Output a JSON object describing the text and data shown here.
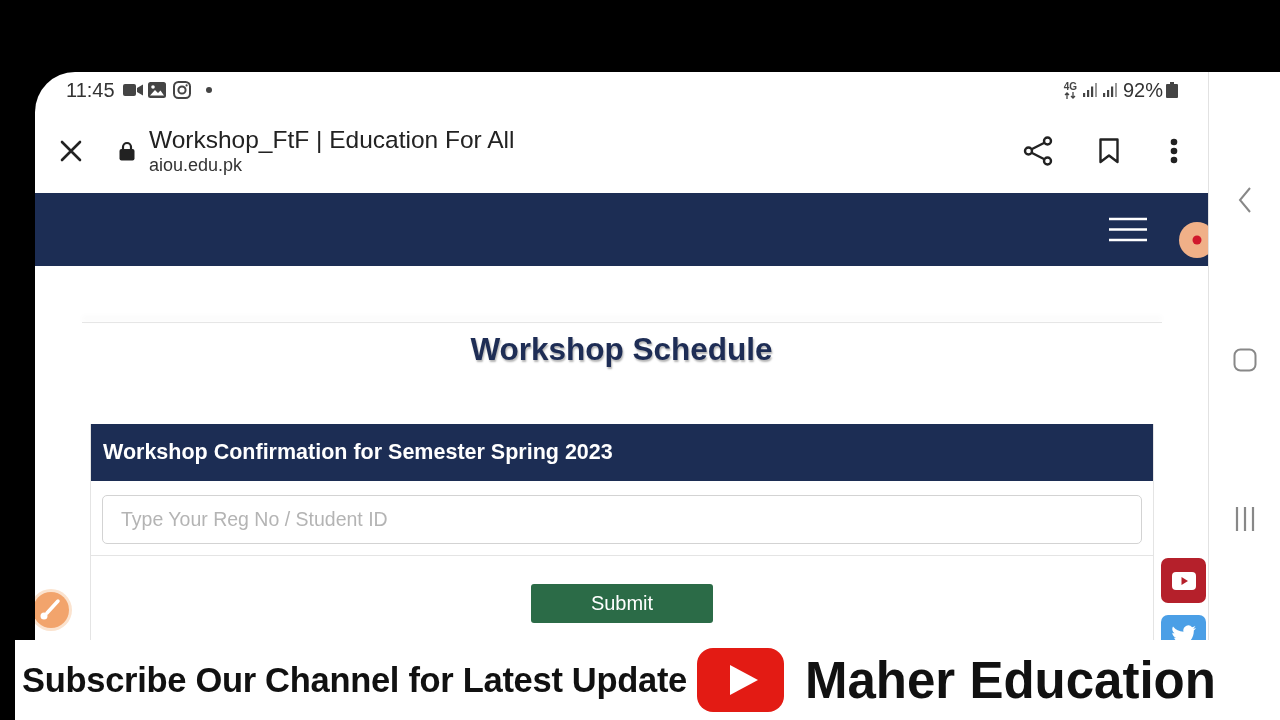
{
  "status_bar": {
    "time": "11:45",
    "network": "4G",
    "battery": "92%"
  },
  "browser_toolbar": {
    "title": "Workshop_FtF | Education For All",
    "url": "aiou.edu.pk"
  },
  "page": {
    "heading": "Workshop Schedule",
    "form": {
      "title": "Workshop Confirmation for Semester Spring 2023",
      "input": {
        "placeholder": "Type Your Reg No / Student ID"
      },
      "submit_button": "Submit"
    }
  },
  "overlay_banner": {
    "text": "Subscribe Our Channel for Latest Update",
    "channel": "Maher Education"
  }
}
